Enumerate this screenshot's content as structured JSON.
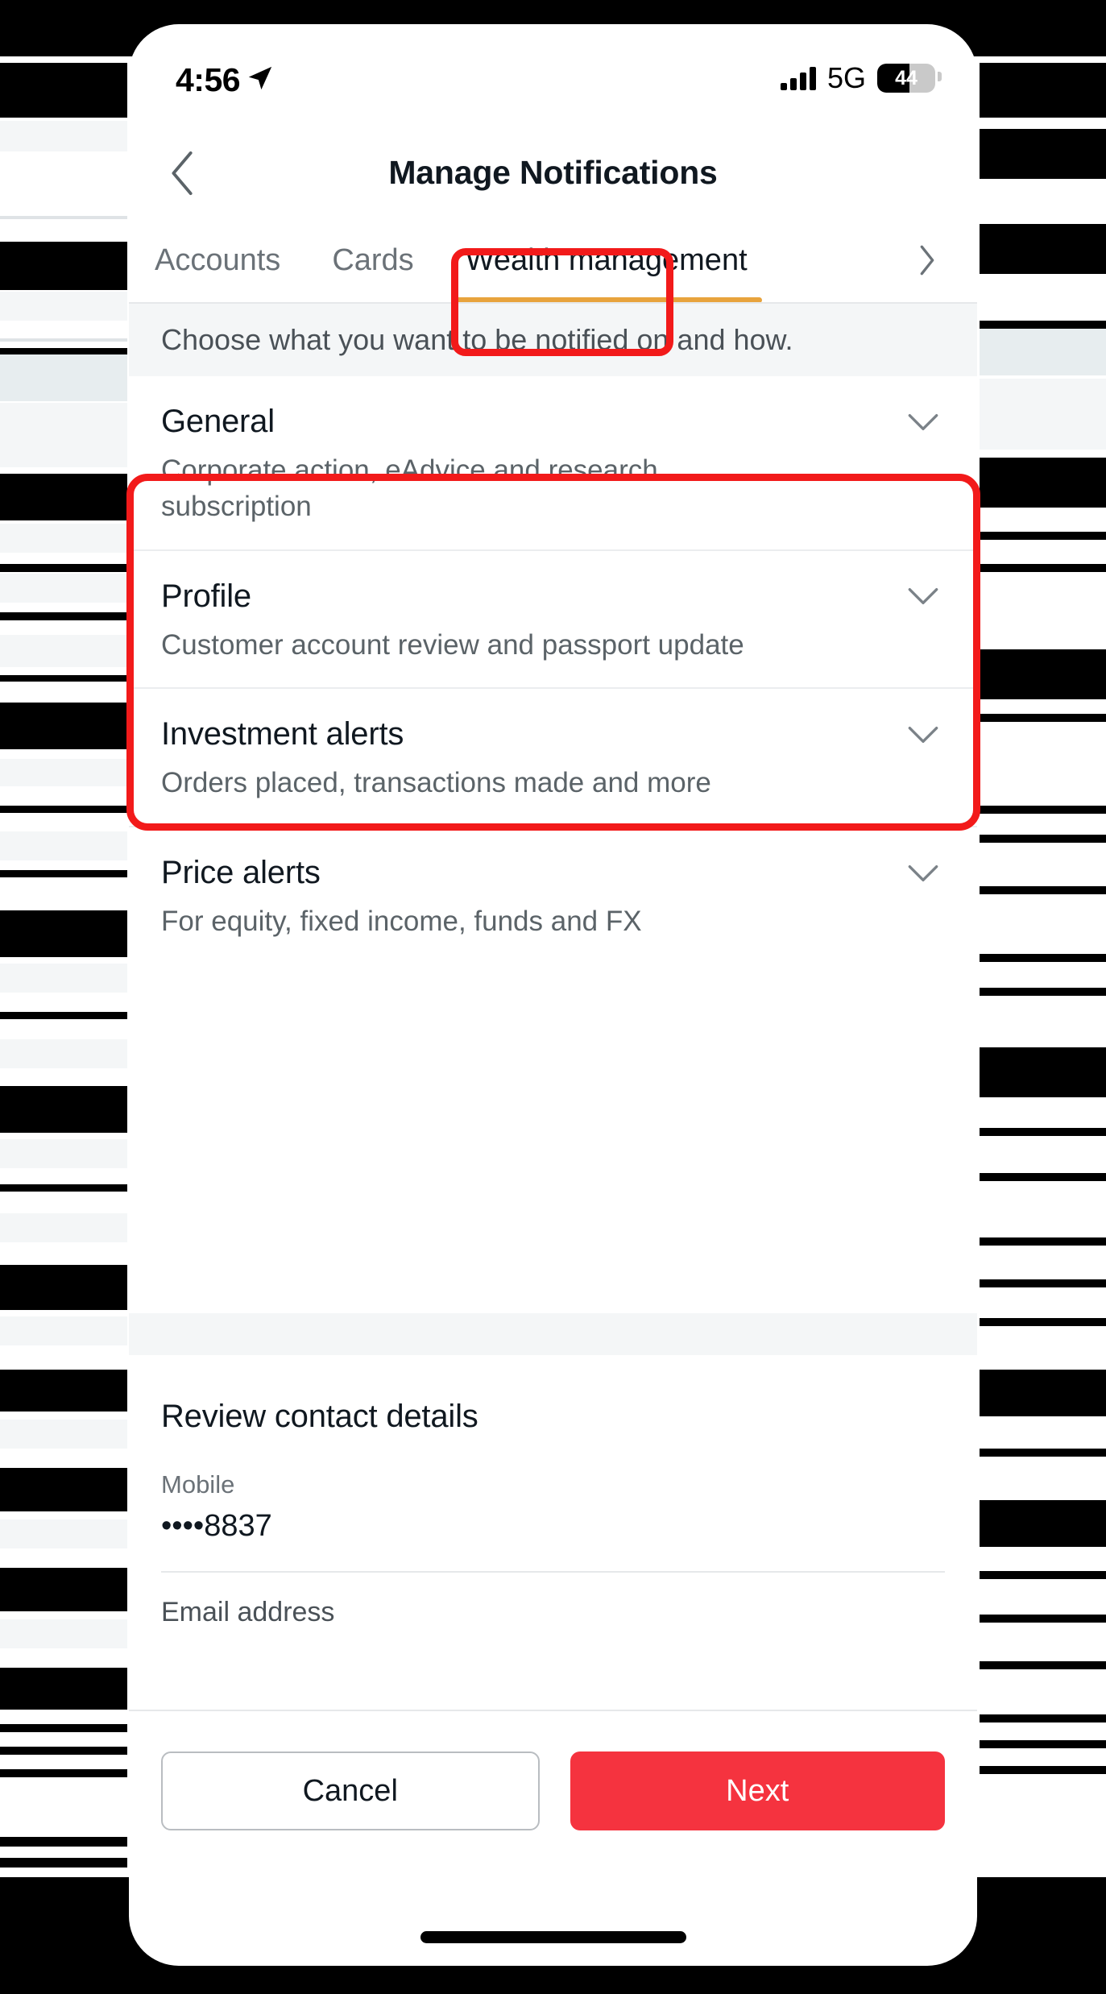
{
  "status_bar": {
    "time": "4:56",
    "location_icon": "location-arrow-icon",
    "network": "5G",
    "battery_level": "44"
  },
  "nav": {
    "back_icon": "chevron-left-icon",
    "title": "Manage Notifications"
  },
  "tabs": {
    "items": [
      {
        "label": "Accounts",
        "active": false
      },
      {
        "label": "Cards",
        "active": false
      },
      {
        "label": "Wealth management",
        "active": true
      }
    ],
    "overflow_icon": "chevron-right-icon"
  },
  "subtitle": "Choose what you want to be notified on and how.",
  "sections": [
    {
      "title": "General",
      "description": "Corporate action, eAdvice and research subscription",
      "chevron": "chevron-down-icon"
    },
    {
      "title": "Profile",
      "description": "Customer account review and passport update",
      "chevron": "chevron-down-icon"
    },
    {
      "title": "Investment alerts",
      "description": "Orders placed, transactions made and more",
      "chevron": "chevron-down-icon"
    },
    {
      "title": "Price alerts",
      "description": "For equity, fixed income, funds and FX",
      "chevron": "chevron-down-icon"
    }
  ],
  "contact": {
    "title": "Review contact details",
    "mobile_label": "Mobile",
    "mobile_value": "••••8837",
    "email_label": "Email address"
  },
  "actions": {
    "cancel_label": "Cancel",
    "next_label": "Next"
  },
  "colors": {
    "primary_red": "#f5333f",
    "annotation_red": "#f21a1a",
    "active_tab_underline": "#e8a33d",
    "text_primary": "#101820",
    "text_secondary": "#5b6368",
    "band_grey": "#f4f6f7"
  }
}
